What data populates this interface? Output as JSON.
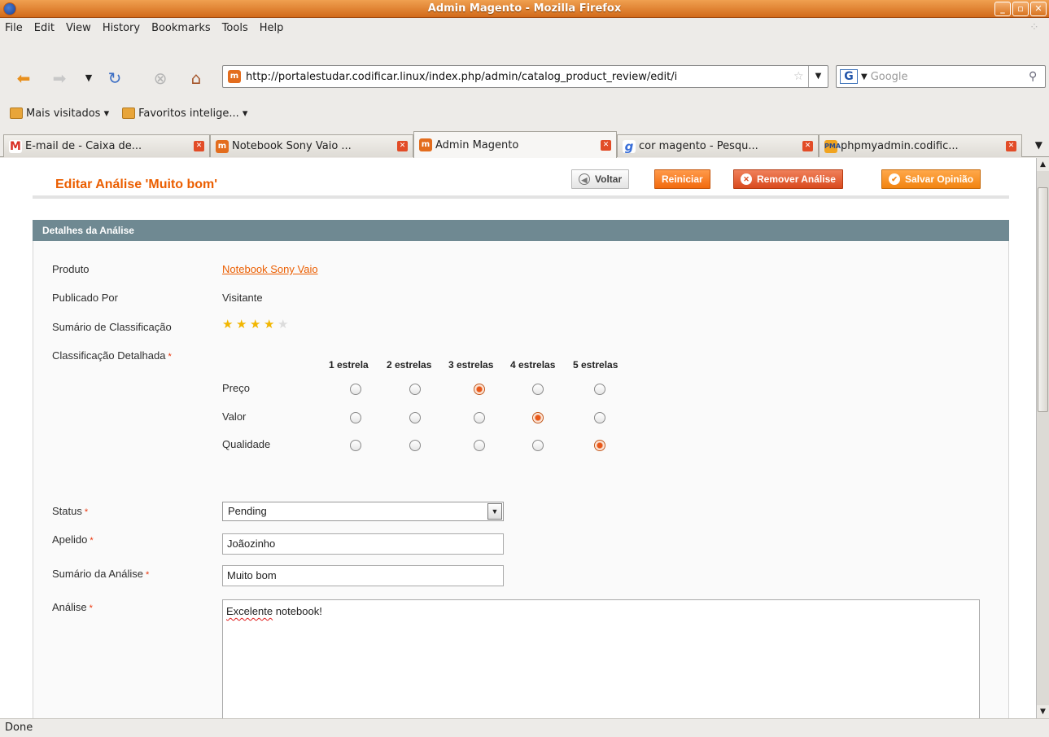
{
  "window": {
    "title": "Admin Magento - Mozilla Firefox"
  },
  "menu": [
    "File",
    "Edit",
    "View",
    "History",
    "Bookmarks",
    "Tools",
    "Help"
  ],
  "navbar": {
    "url": "http://portalestudar.codificar.linux/index.php/admin/catalog_product_review/edit/i",
    "search_placeholder": "Google"
  },
  "bookmarks": [
    "Mais visitados ▾",
    "Favoritos intelige... ▾"
  ],
  "tabs": [
    {
      "label": "E-mail de  - Caixa de...",
      "active": false,
      "icon_color": "#d93025"
    },
    {
      "label": "Notebook Sony Vaio ...",
      "active": false,
      "icon_color": "#e36d1e"
    },
    {
      "label": "Admin Magento",
      "active": true,
      "icon_color": "#e36d1e"
    },
    {
      "label": "cor magento - Pesqu...",
      "active": false,
      "icon_color": "#3a6fd8"
    },
    {
      "label": "phpmyadmin.codific...",
      "active": false,
      "icon_color": "#f1a420"
    }
  ],
  "page": {
    "title": "Editar Análise 'Muito bom'",
    "buttons": {
      "back": "Voltar",
      "reset": "Reiniciar",
      "delete": "Remover Análise",
      "save": "Salvar Opinião"
    },
    "section_title": "Detalhes da Análise",
    "fields": {
      "product_label": "Produto",
      "product_value": "Notebook Sony Vaio",
      "posted_by_label": "Publicado Por",
      "posted_by_value": "Visitante",
      "summary_rating_label": "Sumário de Classificação",
      "summary_rating_stars": 4,
      "summary_rating_max": 5,
      "detailed_rating_label": "Classificação Detalhada",
      "status_label": "Status",
      "status_value": "Pending",
      "nickname_label": "Apelido",
      "nickname_value": "Joãozinho",
      "review_summary_label": "Sumário da Análise",
      "review_summary_value": "Muito bom",
      "review_label": "Análise",
      "review_text_word1": "Excelente",
      "review_text_rest": " notebook!"
    },
    "rating_columns": [
      "1 estrela",
      "2 estrelas",
      "3 estrelas",
      "4 estrelas",
      "5 estrelas"
    ],
    "rating_rows": [
      {
        "label": "Preço",
        "selected": 3
      },
      {
        "label": "Valor",
        "selected": 4
      },
      {
        "label": "Qualidade",
        "selected": 5
      }
    ],
    "required_mark": "*"
  },
  "statusbar": {
    "text": "Done"
  }
}
